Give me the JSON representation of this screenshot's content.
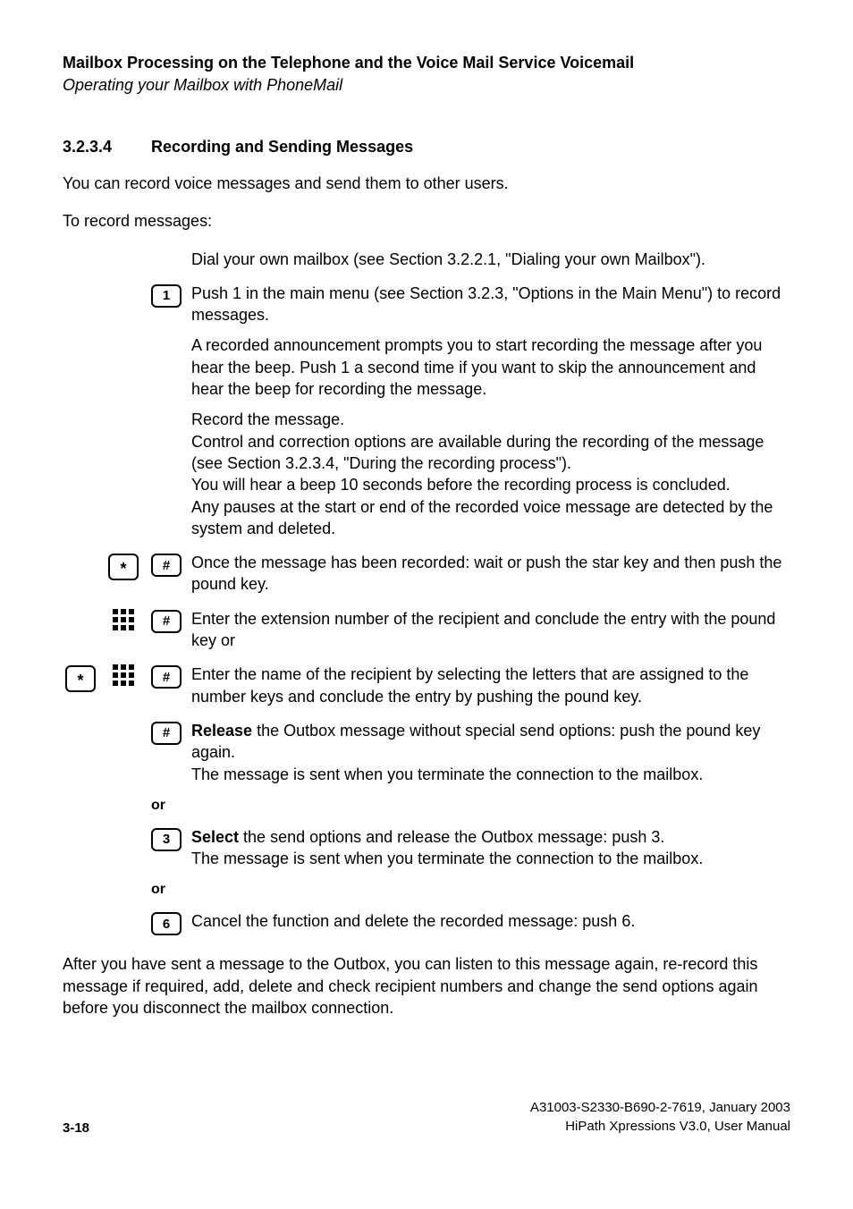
{
  "header": {
    "title": "Mailbox Processing on the Telephone and the Voice Mail Service Voicemail",
    "sub": "Operating your Mailbox with PhoneMail"
  },
  "section": {
    "num": "3.2.3.4",
    "title": "Recording and Sending Messages"
  },
  "intro1": "You can record voice messages and send them to other users.",
  "intro2": "To record messages:",
  "steps": {
    "s0": "Dial your own mailbox (see Section 3.2.2.1, \"Dialing your own Mailbox\").",
    "s1a": "Push 1 in the main menu (see Section 3.2.3, \"Options in the Main Menu\") to record messages.",
    "s1b": "A recorded announcement prompts you to start recording the message after you hear the beep. Push 1 a second time if you want to skip the announcement and hear the beep for recording the message.",
    "s1c": "Record the message.\nControl and correction options are available during the recording of the message (see Section 3.2.3.4, \"During the recording process\").\nYou will hear a beep 10 seconds before the recording process is concluded.\nAny pauses at the start or end of the recorded voice message are detected by the system and deleted.",
    "s2": "Once the message has been recorded: wait or push the star key and then push the pound key.",
    "s3": "Enter the extension number of the recipient and conclude the entry with the pound key or",
    "s4": "Enter the name of the recipient by selecting the letters that are assigned to the number keys and conclude the entry by pushing the pound key.",
    "s5a_strong": "Release",
    "s5a_rest": " the Outbox message without special send options: push the pound key again.\nThe message is sent when you terminate the connection to the mailbox.",
    "or": "or",
    "s6a_strong": "Select",
    "s6a_rest": " the send options and release the Outbox message: push 3.\nThe message is sent when you terminate the connection to the mailbox.",
    "s7": "Cancel the function and delete the recorded message: push 6."
  },
  "keys": {
    "one": "1",
    "star": "*",
    "hash": "#",
    "three": "3",
    "six": "6"
  },
  "closing": "After you have sent a message to the Outbox, you can listen to this message again, re-record this message if required, add, delete and check recipient numbers and change the send options again before you disconnect the mailbox connection.",
  "footer": {
    "page": "3-18",
    "doc_id": "A31003-S2330-B690-2-7619, January 2003",
    "product": "HiPath Xpressions V3.0, User Manual"
  }
}
